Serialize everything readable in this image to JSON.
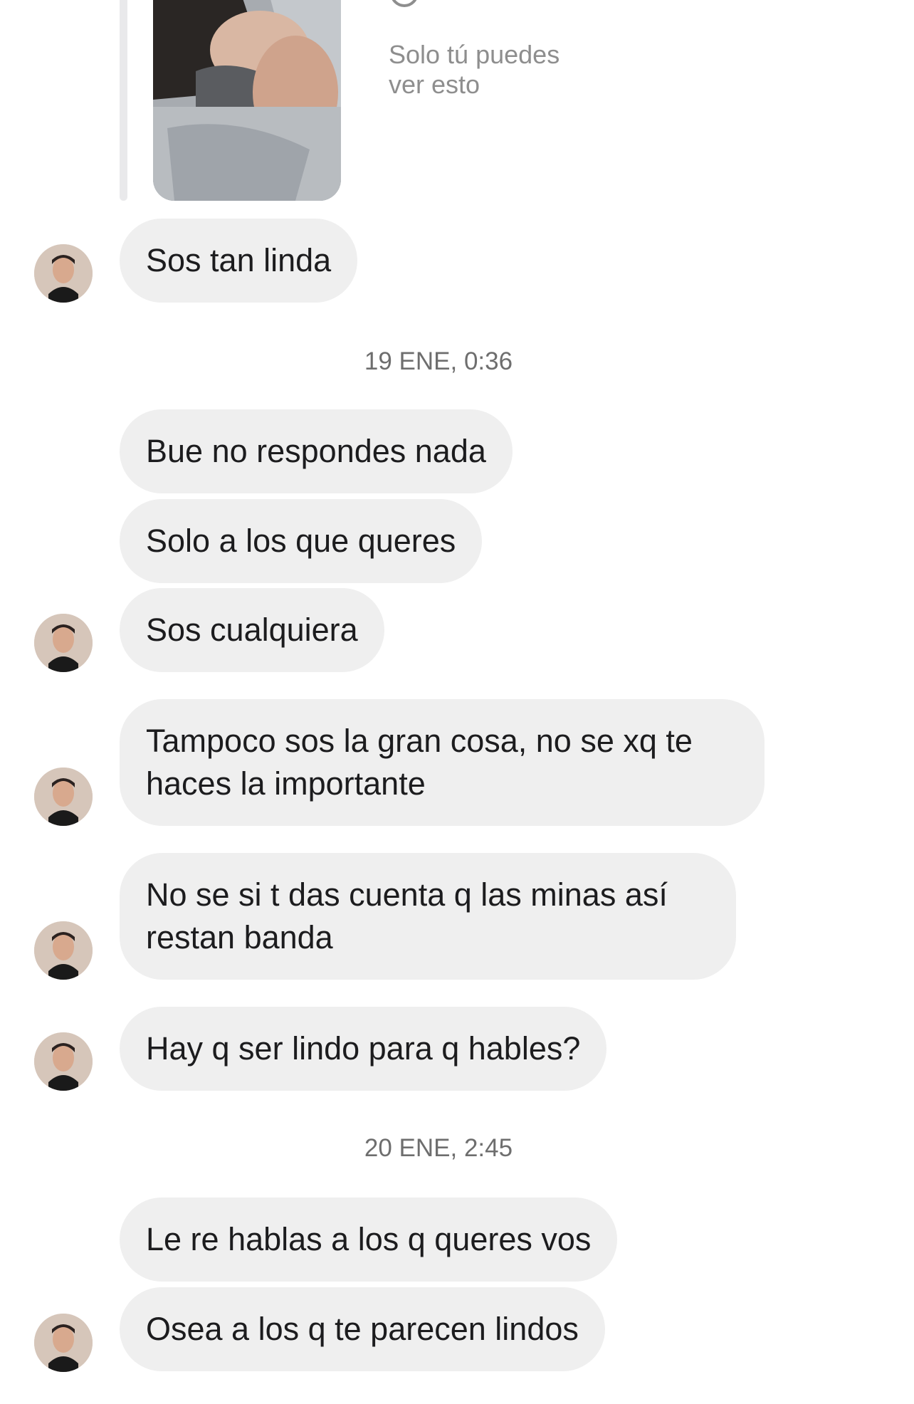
{
  "photo_message": {
    "icon": "photo-thumbnail",
    "status_icon": "loading-circle-icon",
    "notice": "Solo tú puedes ver esto"
  },
  "contact": {
    "avatar_icon": "avatar-photo"
  },
  "messages": [
    {
      "text": "Sos tan linda"
    },
    {
      "text": "Bue no respondes nada"
    },
    {
      "text": "Solo a los que queres"
    },
    {
      "text": "Sos cualquiera"
    },
    {
      "text": "Tampoco sos la gran cosa, no se xq te haces la importante"
    },
    {
      "text": "No se si t das cuenta q las minas así restan banda"
    },
    {
      "text": "Hay q ser lindo para q hables?"
    },
    {
      "text": "Le re hablas a los q queres vos"
    },
    {
      "text": "Osea a los q te parecen lindos"
    }
  ],
  "timestamps": [
    "19 ENE, 0:36",
    "20 ENE, 2:45"
  ],
  "colors": {
    "bubble_background": "#efefef",
    "text": "#1c1c1e",
    "timestamp": "#6e6e6e",
    "notice": "#8e8e8e"
  }
}
